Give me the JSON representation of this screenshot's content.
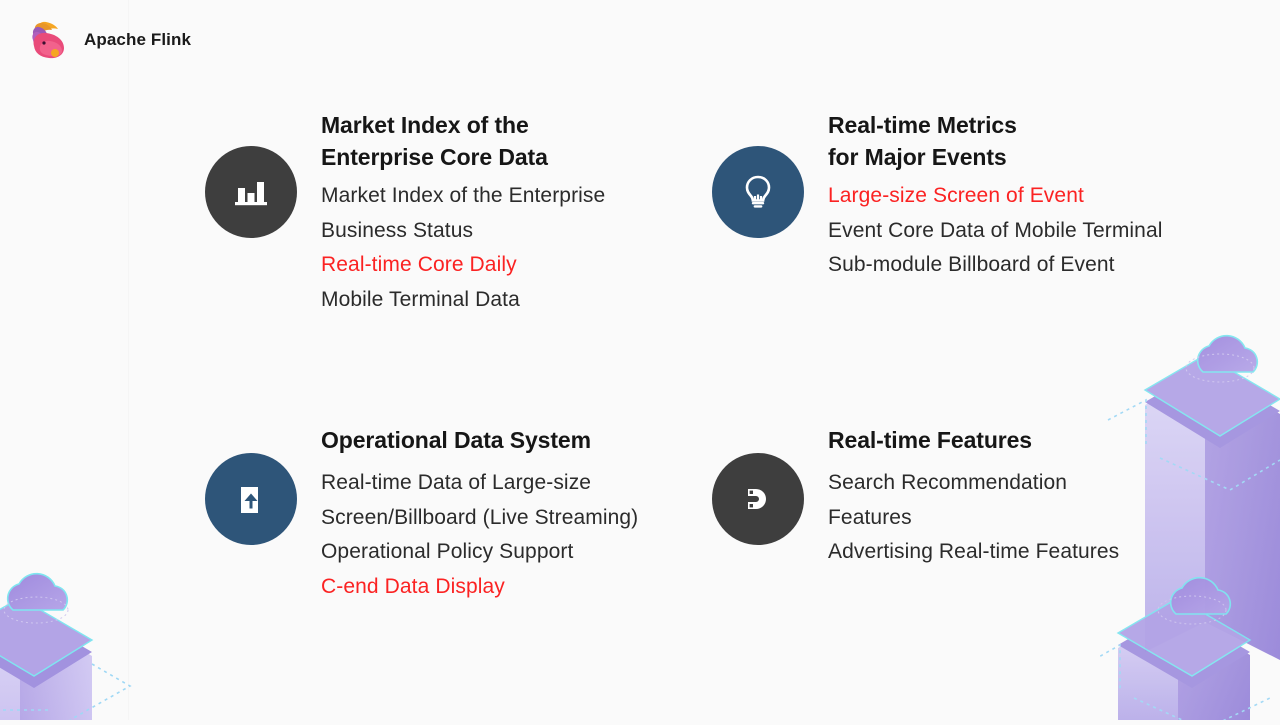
{
  "brand": {
    "name": "Apache Flink",
    "logo_icon": "flink-squirrel-logo"
  },
  "colors": {
    "background": "#fafafa",
    "circle_dark": "#3e3e3e",
    "circle_navy": "#2e5579",
    "heading_text": "#161616",
    "body_text": "#2b2b2b",
    "highlight_red": "#fb2222",
    "deco_purple": "#8f7fd8",
    "deco_cyan": "#7fe6f0"
  },
  "items": [
    {
      "icon": "bar-chart-icon",
      "icon_style": "dark",
      "heading": "Market Index of the\nEnterprise Core Data",
      "lines": [
        {
          "text": "Market Index of the Enterprise",
          "highlight": false
        },
        {
          "text": "Business Status",
          "highlight": false
        },
        {
          "text": "Real-time Core Daily",
          "highlight": true
        },
        {
          "text": "Mobile Terminal Data",
          "highlight": false
        }
      ]
    },
    {
      "icon": "lightbulb-icon",
      "icon_style": "navy",
      "heading": "Real-time Metrics\nfor Major Events",
      "lines": [
        {
          "text": "Large-size Screen of Event",
          "highlight": true
        },
        {
          "text": "Event Core Data of Mobile Terminal",
          "highlight": false
        },
        {
          "text": "Sub-module Billboard of Event",
          "highlight": false
        }
      ]
    },
    {
      "icon": "document-upload-icon",
      "icon_style": "navy",
      "heading": "Operational Data System",
      "lines": [
        {
          "text": "Real-time Data of Large-size",
          "highlight": false
        },
        {
          "text": "Screen/Billboard (Live Streaming)",
          "highlight": false
        },
        {
          "text": "Operational Policy Support",
          "highlight": false
        },
        {
          "text": "C-end Data Display",
          "highlight": true
        }
      ]
    },
    {
      "icon": "magnet-icon",
      "icon_style": "dark",
      "heading": "Real-time Features",
      "lines": [
        {
          "text": "Search Recommendation",
          "highlight": false
        },
        {
          "text": "Features",
          "highlight": false
        },
        {
          "text": "Advertising Real-time Features",
          "highlight": false
        }
      ]
    }
  ],
  "decoration": {
    "right_art": "isometric-cloud-pillars",
    "left_art": "isometric-cloud-pillar"
  }
}
